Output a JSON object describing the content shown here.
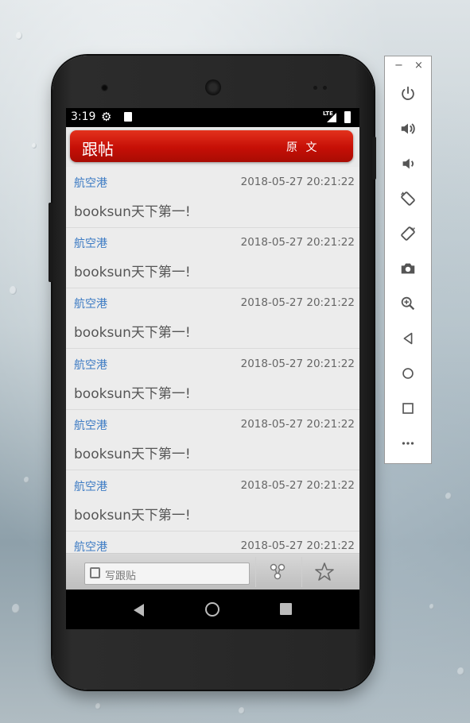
{
  "status_bar": {
    "time": "3:19",
    "network": "LTE"
  },
  "app_bar": {
    "title": "跟帖",
    "original_label": "原 文"
  },
  "posts": [
    {
      "user": "航空港",
      "time": "2018-05-27 20:21:22",
      "content": "booksun天下第一!"
    },
    {
      "user": "航空港",
      "time": "2018-05-27 20:21:22",
      "content": "booksun天下第一!"
    },
    {
      "user": "航空港",
      "time": "2018-05-27 20:21:22",
      "content": "booksun天下第一!"
    },
    {
      "user": "航空港",
      "time": "2018-05-27 20:21:22",
      "content": "booksun天下第一!"
    },
    {
      "user": "航空港",
      "time": "2018-05-27 20:21:22",
      "content": "booksun天下第一!"
    },
    {
      "user": "航空港",
      "time": "2018-05-27 20:21:22",
      "content": "booksun天下第一!"
    },
    {
      "user": "航空港",
      "time": "2018-05-27 20:21:22",
      "content": ""
    }
  ],
  "bottom_bar": {
    "reply_label": "写跟贴",
    "share_icon": "share-icon",
    "favorite_icon": "star-icon"
  },
  "emulator_panel": {
    "minimize": "−",
    "close": "×",
    "tools": [
      "power-icon",
      "volume-up-icon",
      "volume-down-icon",
      "rotate-left-icon",
      "rotate-right-icon",
      "camera-icon",
      "zoom-icon",
      "back-icon",
      "home-icon",
      "overview-icon",
      "more-icon"
    ]
  },
  "colors": {
    "accent_red": "#c60f06",
    "link_blue": "#3e7cc4"
  }
}
